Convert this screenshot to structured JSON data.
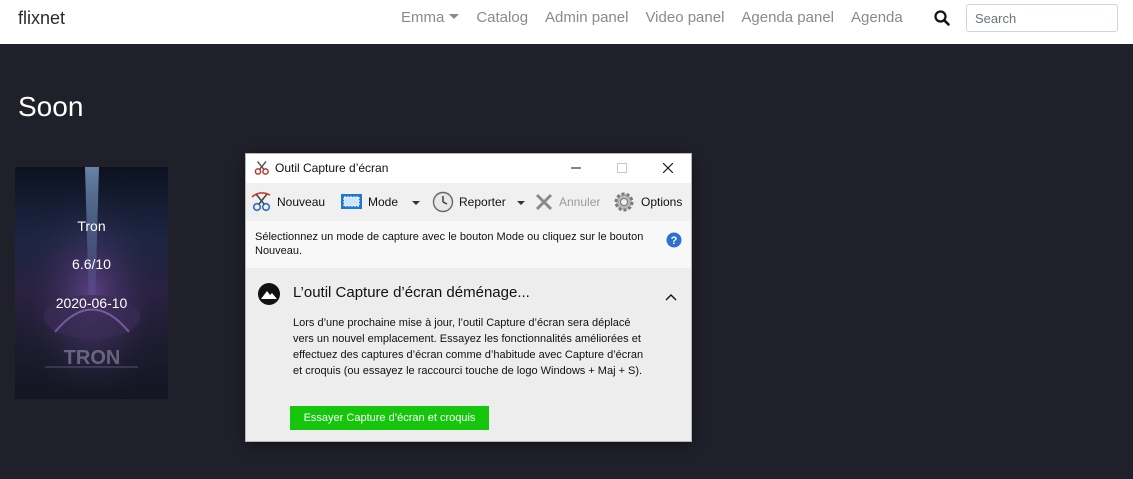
{
  "navbar": {
    "brand": "flixnet",
    "links": [
      {
        "label": "Emma"
      },
      {
        "label": "Catalog"
      },
      {
        "label": "Admin panel"
      },
      {
        "label": "Video panel"
      },
      {
        "label": "Agenda panel"
      },
      {
        "label": "Agenda"
      }
    ],
    "search_icon": "search-icon",
    "search_placeholder": "Search"
  },
  "page": {
    "title": "Soon",
    "movies": [
      {
        "title": "Tron",
        "rating": "6.6/10",
        "date": "2020-06-10",
        "poster_word": "TRON"
      }
    ]
  },
  "snipping_tool": {
    "window_title": "Outil Capture d’écran",
    "toolbar": {
      "new_label": "Nouveau",
      "mode_label": "Mode",
      "delay_label": "Reporter",
      "cancel_label": "Annuler",
      "options_label": "Options"
    },
    "info_text": "Sélectionnez un mode de capture avec le bouton Mode ou cliquez sur le bouton Nouveau.",
    "notice_title": "L’outil Capture d’écran déménage...",
    "notice_body": "Lors d’une prochaine mise à jour, l’outil Capture d’écran sera déplacé vers un nouvel emplacement. Essayez les fonctionnalités améliorées et effectuez des captures d’écran comme d’habitude avec Capture d’écran et croquis (ou essayez le raccourci touche de logo Windows + Maj + S).",
    "try_button": "Essayer Capture d’écran et croquis"
  },
  "colors": {
    "page_bg": "#1f202a",
    "navbar_bg": "#ffffff",
    "try_button_bg": "#16c60c"
  }
}
